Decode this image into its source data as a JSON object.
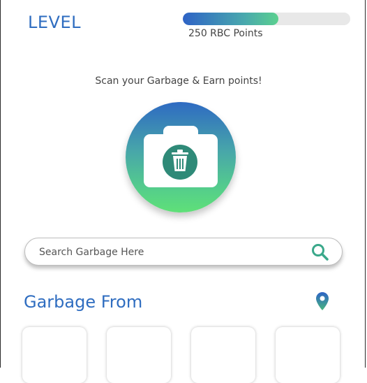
{
  "header": {
    "level_label": "LEVEL",
    "points_text": "250 RBC Points",
    "progress_fraction": 0.57,
    "progress_colors": [
      "#2e63c6",
      "#5bd08f"
    ]
  },
  "scan": {
    "caption": "Scan your Garbage & Earn points!",
    "icon": "camera-trash-icon",
    "gradient_colors": [
      "#2e6ac2",
      "#5fe078"
    ]
  },
  "search": {
    "placeholder": "Search Garbage Here",
    "value": "",
    "icon": "search-icon"
  },
  "garbage_from": {
    "title": "Garbage From",
    "location_icon": "location-pin-icon",
    "cards": [
      {},
      {},
      {},
      {}
    ]
  },
  "colors": {
    "accent_blue": "#2f6dc0",
    "accent_green": "#3aa88a"
  }
}
